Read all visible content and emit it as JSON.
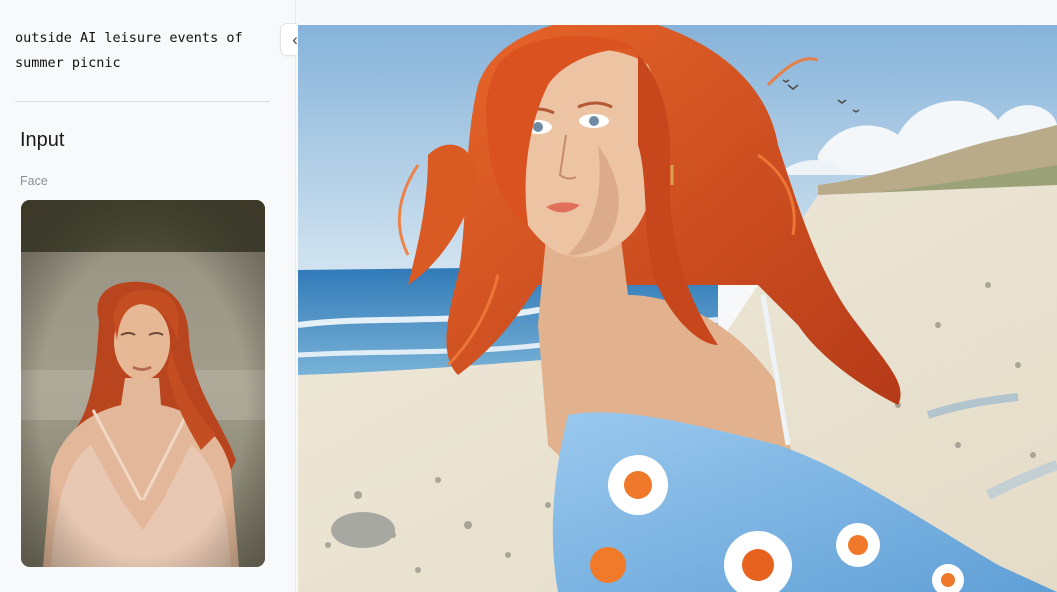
{
  "sidebar": {
    "prompt_text": "outside AI leisure events of summer picnic",
    "section_title": "Input",
    "face_label": "Face",
    "face_image": "face-photo-redhead-woman"
  },
  "controls": {
    "collapse_icon": "chevrons-left-icon",
    "collapse_glyph": "«"
  },
  "main": {
    "output_image": "illustration-redhead-woman-on-beach"
  },
  "colors": {
    "sidebar_bg": "#f8f9fb",
    "divider": "#d8dbe0",
    "hair": "#d5531f",
    "dress": "#7fb8e6",
    "sky": "#a9cbe6",
    "sea": "#3d8bc6",
    "sand": "#ece6d6"
  }
}
